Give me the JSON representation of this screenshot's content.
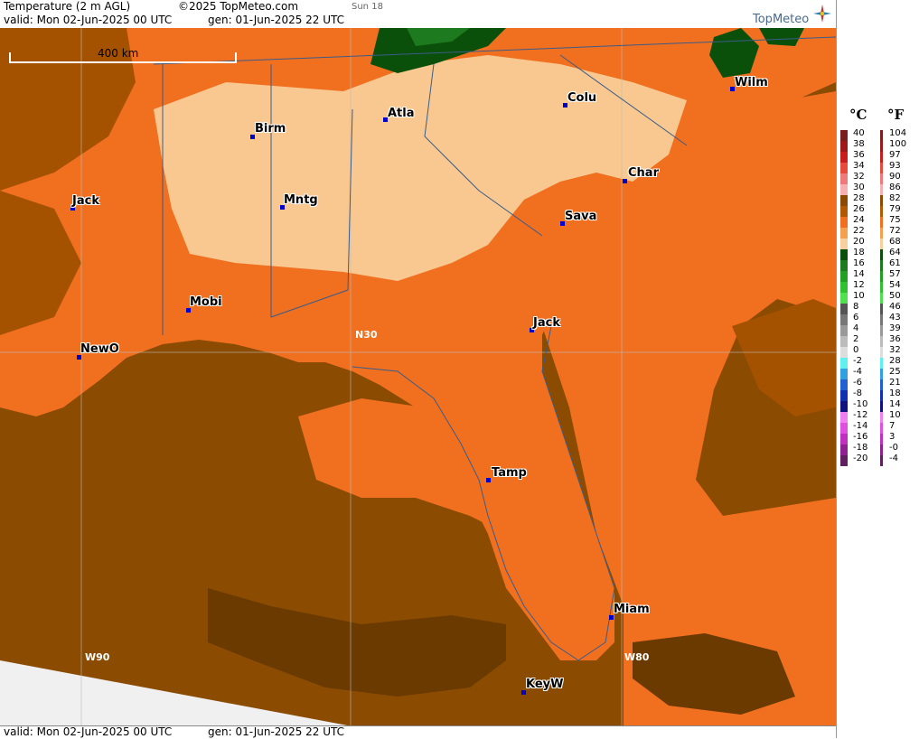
{
  "header": {
    "title": "Temperature (2 m AGL)",
    "copyright": "©2025 TopMeteo.com",
    "run": "Sun 18",
    "valid": "valid:  Mon  02-Jun-2025  00 UTC",
    "gen": "gen:  01-Jun-2025 22 UTC"
  },
  "brand": "TopMeteo",
  "footer": {
    "valid": "valid:  Mon  02-Jun-2025  00 UTC",
    "gen": "gen:  01-Jun-2025 22 UTC"
  },
  "scale_label": "400 km",
  "grid_labels": {
    "n30": "N30",
    "w90": "W90",
    "w80": "W80"
  },
  "cities": {
    "birm": "Birm",
    "atla": "Atla",
    "colu": "Colu",
    "wilm": "Wilm",
    "jack_ms": "Jack",
    "mntg": "Mntg",
    "char": "Char",
    "sava": "Sava",
    "mobi": "Mobi",
    "jack_fl": "Jack",
    "newo": "NewO",
    "tamp": "Tamp",
    "miam": "Miam",
    "keyw": "KeyW"
  },
  "legend": {
    "celsius_label": "°C",
    "fahrenheit_label": "°F",
    "celsius": [
      "40",
      "38",
      "36",
      "34",
      "32",
      "30",
      "28",
      "26",
      "24",
      "22",
      "20",
      "18",
      "16",
      "14",
      "12",
      "10",
      "8",
      "6",
      "4",
      "2",
      "0",
      "-2",
      "-4",
      "-6",
      "-8",
      "-10",
      "-12",
      "-14",
      "-16",
      "-18",
      "-20"
    ],
    "fahrenheit": [
      "104",
      "100",
      "97",
      "93",
      "90",
      "86",
      "82",
      "79",
      "75",
      "72",
      "68",
      "64",
      "61",
      "57",
      "54",
      "50",
      "46",
      "43",
      "39",
      "36",
      "32",
      "28",
      "25",
      "21",
      "18",
      "14",
      "10",
      "7",
      "3",
      "-0",
      "-4"
    ],
    "colors": [
      "#7a1f1f",
      "#9e1a1a",
      "#c81e1e",
      "#e84a3c",
      "#f07a7a",
      "#f6b0b0",
      "#8b4a00",
      "#b35a00",
      "#f07020",
      "#f4a050",
      "#f8d0a0",
      "#0a4f0a",
      "#1e7a1e",
      "#22a022",
      "#30c030",
      "#50e050",
      "#555555",
      "#777777",
      "#999999",
      "#bbbbbb",
      "#dddddd",
      "#60f0f0",
      "#30a0e0",
      "#2060d0",
      "#1030b0",
      "#101080",
      "#f080f0",
      "#e050e0",
      "#c030c0",
      "#902090",
      "#602060"
    ]
  },
  "colors": {
    "land_warm": "#f07a20",
    "land_hot_pale": "#f8c890",
    "sea": "#8b4b00",
    "border": "#3a5c8a"
  }
}
